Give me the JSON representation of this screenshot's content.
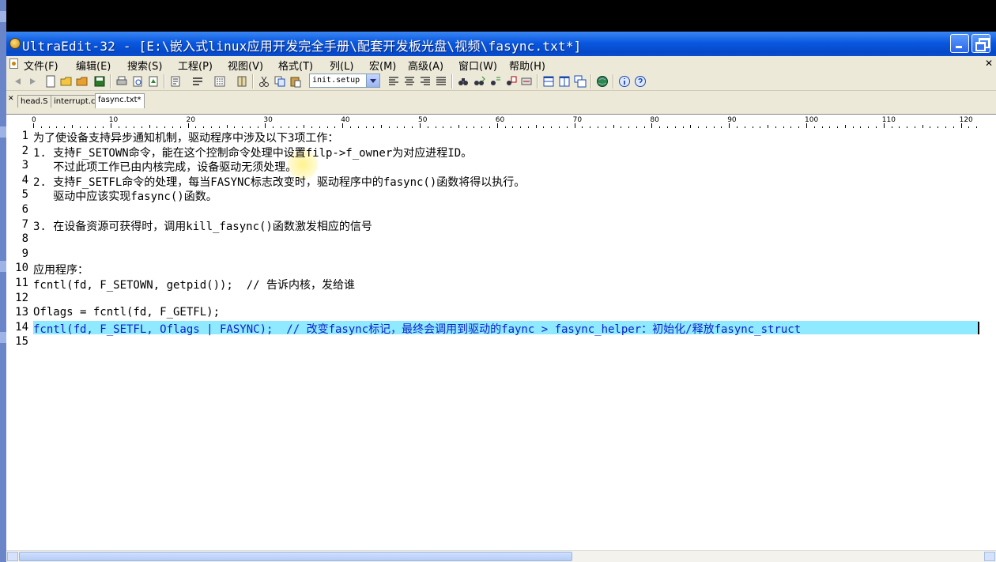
{
  "window": {
    "title": "UltraEdit-32 - [E:\\嵌入式linux应用开发完全手册\\配套开发板光盘\\视频\\fasync.txt*]"
  },
  "menu": [
    "文件(F)",
    "编辑(E)",
    "搜索(S)",
    "工程(P)",
    "视图(V)",
    "格式(T)",
    "列(L)",
    "宏(M)",
    "高级(A)",
    "窗口(W)",
    "帮助(H)"
  ],
  "toolbar": {
    "macro_value": "init.setup",
    "icons": [
      "back-icon",
      "forward-icon",
      "new-file-icon",
      "open-folder-icon",
      "open-file-icon",
      "save-icon",
      "print-icon",
      "print-preview-icon",
      "print-setup-icon",
      "properties-icon",
      "word-wrap-icon",
      "hex-icon",
      "column-mode-icon",
      "cut-icon",
      "copy-icon",
      "paste-icon",
      "align-left-icon",
      "align-center-icon",
      "align-right-icon",
      "justify-icon",
      "find-icon",
      "find-next-icon",
      "replace-icon",
      "find-in-files-icon",
      "spell-check-icon",
      "split-horizontal-icon",
      "split-vertical-icon",
      "cascade-icon",
      "browser-icon",
      "info-icon",
      "help-icon"
    ]
  },
  "tabs": [
    {
      "label": "head.S",
      "active": false
    },
    {
      "label": "interrupt.c",
      "active": false
    },
    {
      "label": "fasync.txt*",
      "active": true
    }
  ],
  "ruler": [
    "0",
    "10",
    "20",
    "30",
    "40",
    "50",
    "60",
    "70",
    "80",
    "90",
    "100",
    "110",
    "120"
  ],
  "lines": [
    {
      "n": "1",
      "text": "为了使设备支持异步通知机制，驱动程序中涉及以下3项工作："
    },
    {
      "n": "2",
      "text": "1. 支持F_SETOWN命令，能在这个控制命令处理中设置filp->f_owner为对应进程ID。"
    },
    {
      "n": "3",
      "text": "   不过此项工作已由内核完成，设备驱动无须处理。"
    },
    {
      "n": "4",
      "text": "2. 支持F_SETFL命令的处理，每当FASYNC标志改变时，驱动程序中的fasync()函数将得以执行。"
    },
    {
      "n": "5",
      "text": "   驱动中应该实现fasync()函数。"
    },
    {
      "n": "6",
      "text": ""
    },
    {
      "n": "7",
      "text": "3. 在设备资源可获得时，调用kill_fasync()函数激发相应的信号"
    },
    {
      "n": "8",
      "text": ""
    },
    {
      "n": "9",
      "text": ""
    },
    {
      "n": "10",
      "text": "应用程序："
    },
    {
      "n": "11",
      "text": "fcntl(fd, F_SETOWN, getpid());  // 告诉内核，发给谁"
    },
    {
      "n": "12",
      "text": ""
    },
    {
      "n": "13",
      "text": "Oflags = fcntl(fd, F_GETFL);"
    },
    {
      "n": "14",
      "text": "fcntl(fd, F_SETFL, Oflags | FASYNC);  // 改变fasync标记，最终会调用到驱动的faync > fasync_helper：初始化/释放fasync_struct"
    },
    {
      "n": "15",
      "text": ""
    }
  ],
  "highlight_color": "#8fe9ff",
  "code_color_highlight": "#1020c8"
}
